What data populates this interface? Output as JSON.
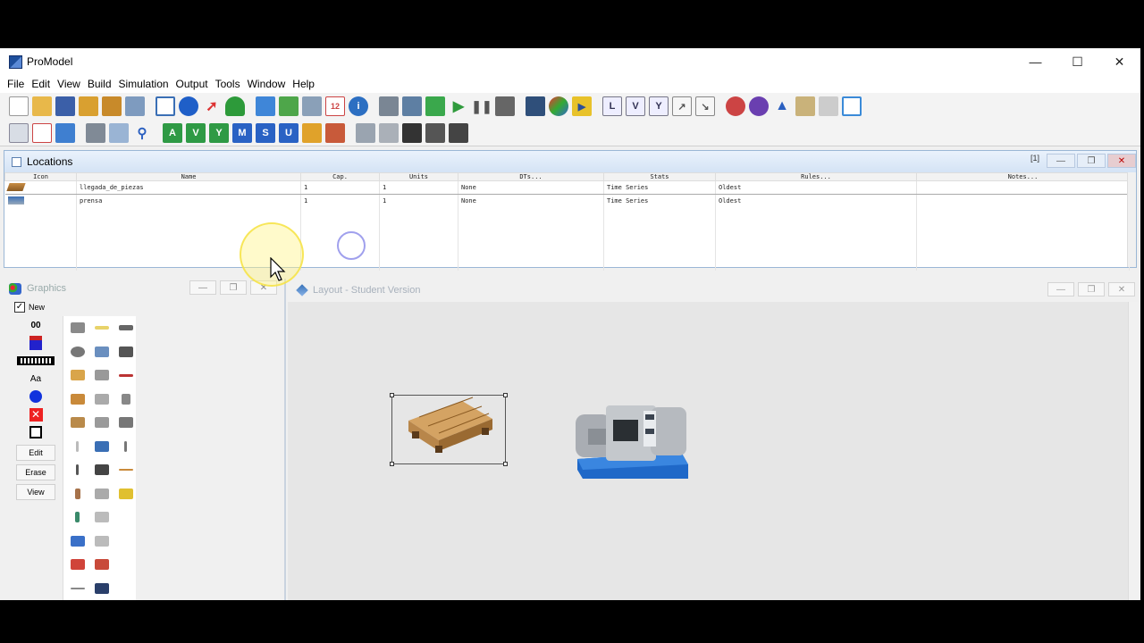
{
  "window": {
    "title": "ProModel"
  },
  "menu": [
    "File",
    "Edit",
    "View",
    "Build",
    "Simulation",
    "Output",
    "Tools",
    "Window",
    "Help"
  ],
  "toolbar2_letters": [
    "A",
    "V",
    "Y",
    "M",
    "S",
    "U"
  ],
  "locations": {
    "title": "Locations",
    "count": "[1]",
    "columns": [
      "Icon",
      "Name",
      "Cap.",
      "Units",
      "DTs...",
      "Stats",
      "Rules...",
      "Notes..."
    ],
    "rows": [
      {
        "name": "llegada_de_piezas",
        "cap": "1",
        "units": "1",
        "dts": "None",
        "stats": "Time Series",
        "rules": "Oldest",
        "notes": ""
      },
      {
        "name": "prensa",
        "cap": "1",
        "units": "1",
        "dts": "None",
        "stats": "Time Series",
        "rules": "Oldest",
        "notes": ""
      }
    ]
  },
  "graphics": {
    "title": "Graphics",
    "new_label": "New",
    "counter": "00",
    "text_tool": "Aa",
    "edit_btn": "Edit",
    "erase_btn": "Erase",
    "view_btn": "View"
  },
  "layout": {
    "title": "Layout - Student Version"
  },
  "colors": {
    "accent": "#3a6fb5",
    "panel_header": "#d4e3f5"
  }
}
